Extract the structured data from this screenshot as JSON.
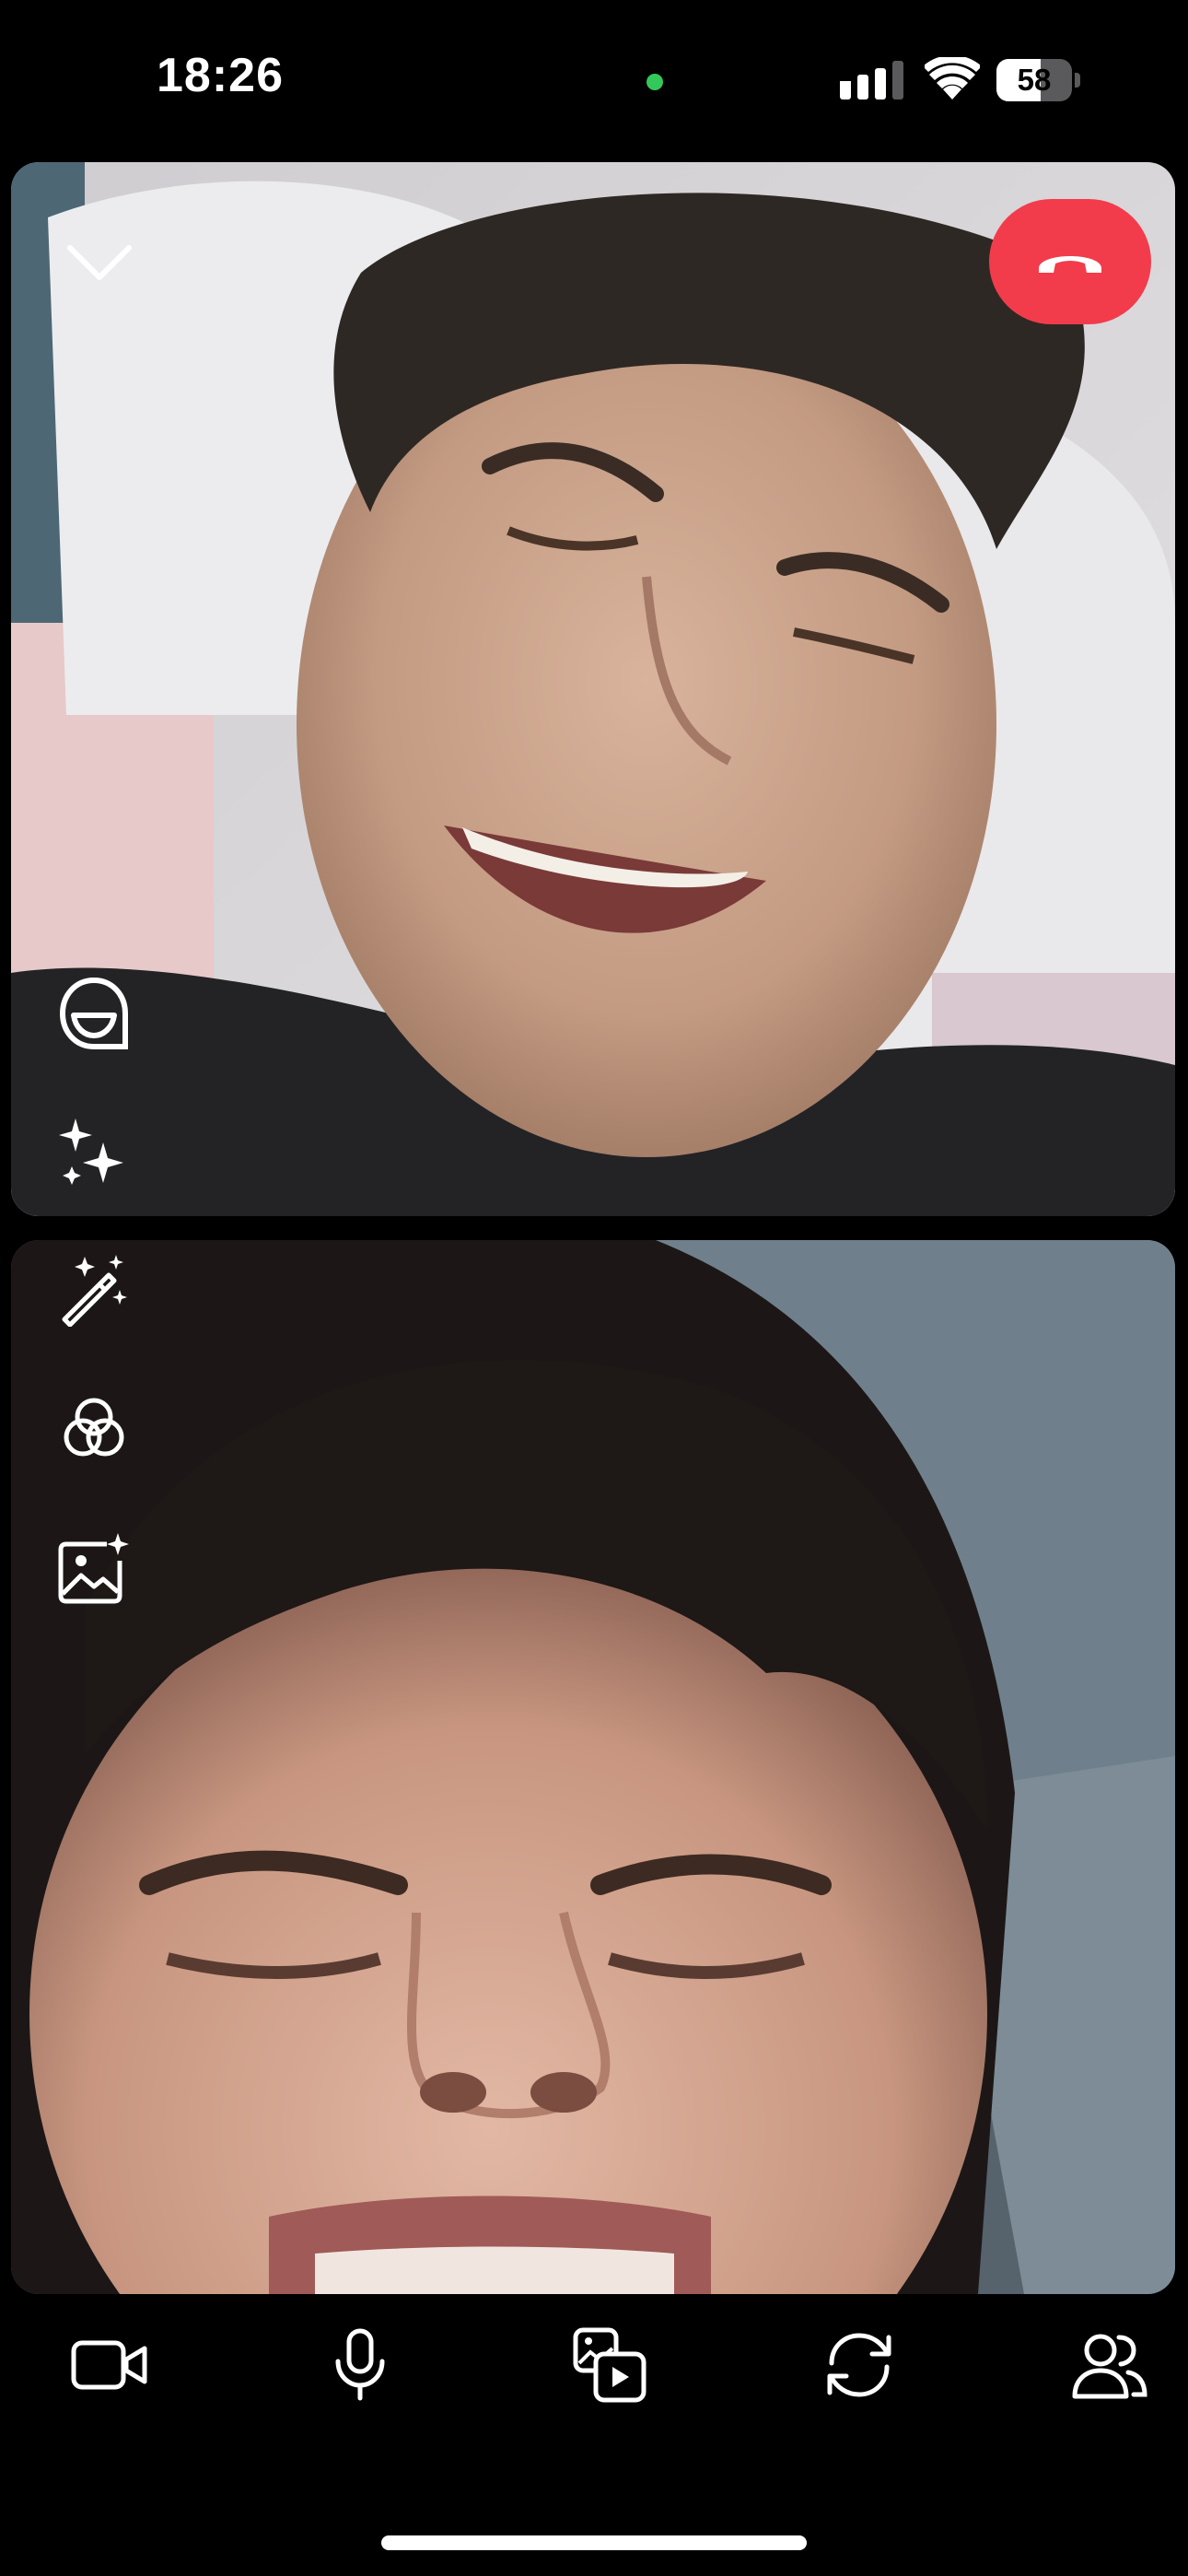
{
  "status_bar": {
    "time": "18:26",
    "battery_percent": "58",
    "battery_level": 0.58,
    "mic_indicator_color": "#34c759"
  },
  "call": {
    "end_call_color": "#f23c4b",
    "remote_feed": "remote-participant-video",
    "self_feed": "self-camera-video"
  },
  "overlay_tools": [
    {
      "icon": "face-lens-icon"
    },
    {
      "icon": "sparkles-icon"
    },
    {
      "icon": "magic-wand-icon"
    },
    {
      "icon": "color-filter-icon"
    },
    {
      "icon": "image-sparkle-icon"
    }
  ],
  "toolbar": [
    {
      "icon": "video-camera-icon"
    },
    {
      "icon": "microphone-icon"
    },
    {
      "icon": "media-share-icon"
    },
    {
      "icon": "flip-camera-icon"
    },
    {
      "icon": "participants-icon"
    }
  ]
}
